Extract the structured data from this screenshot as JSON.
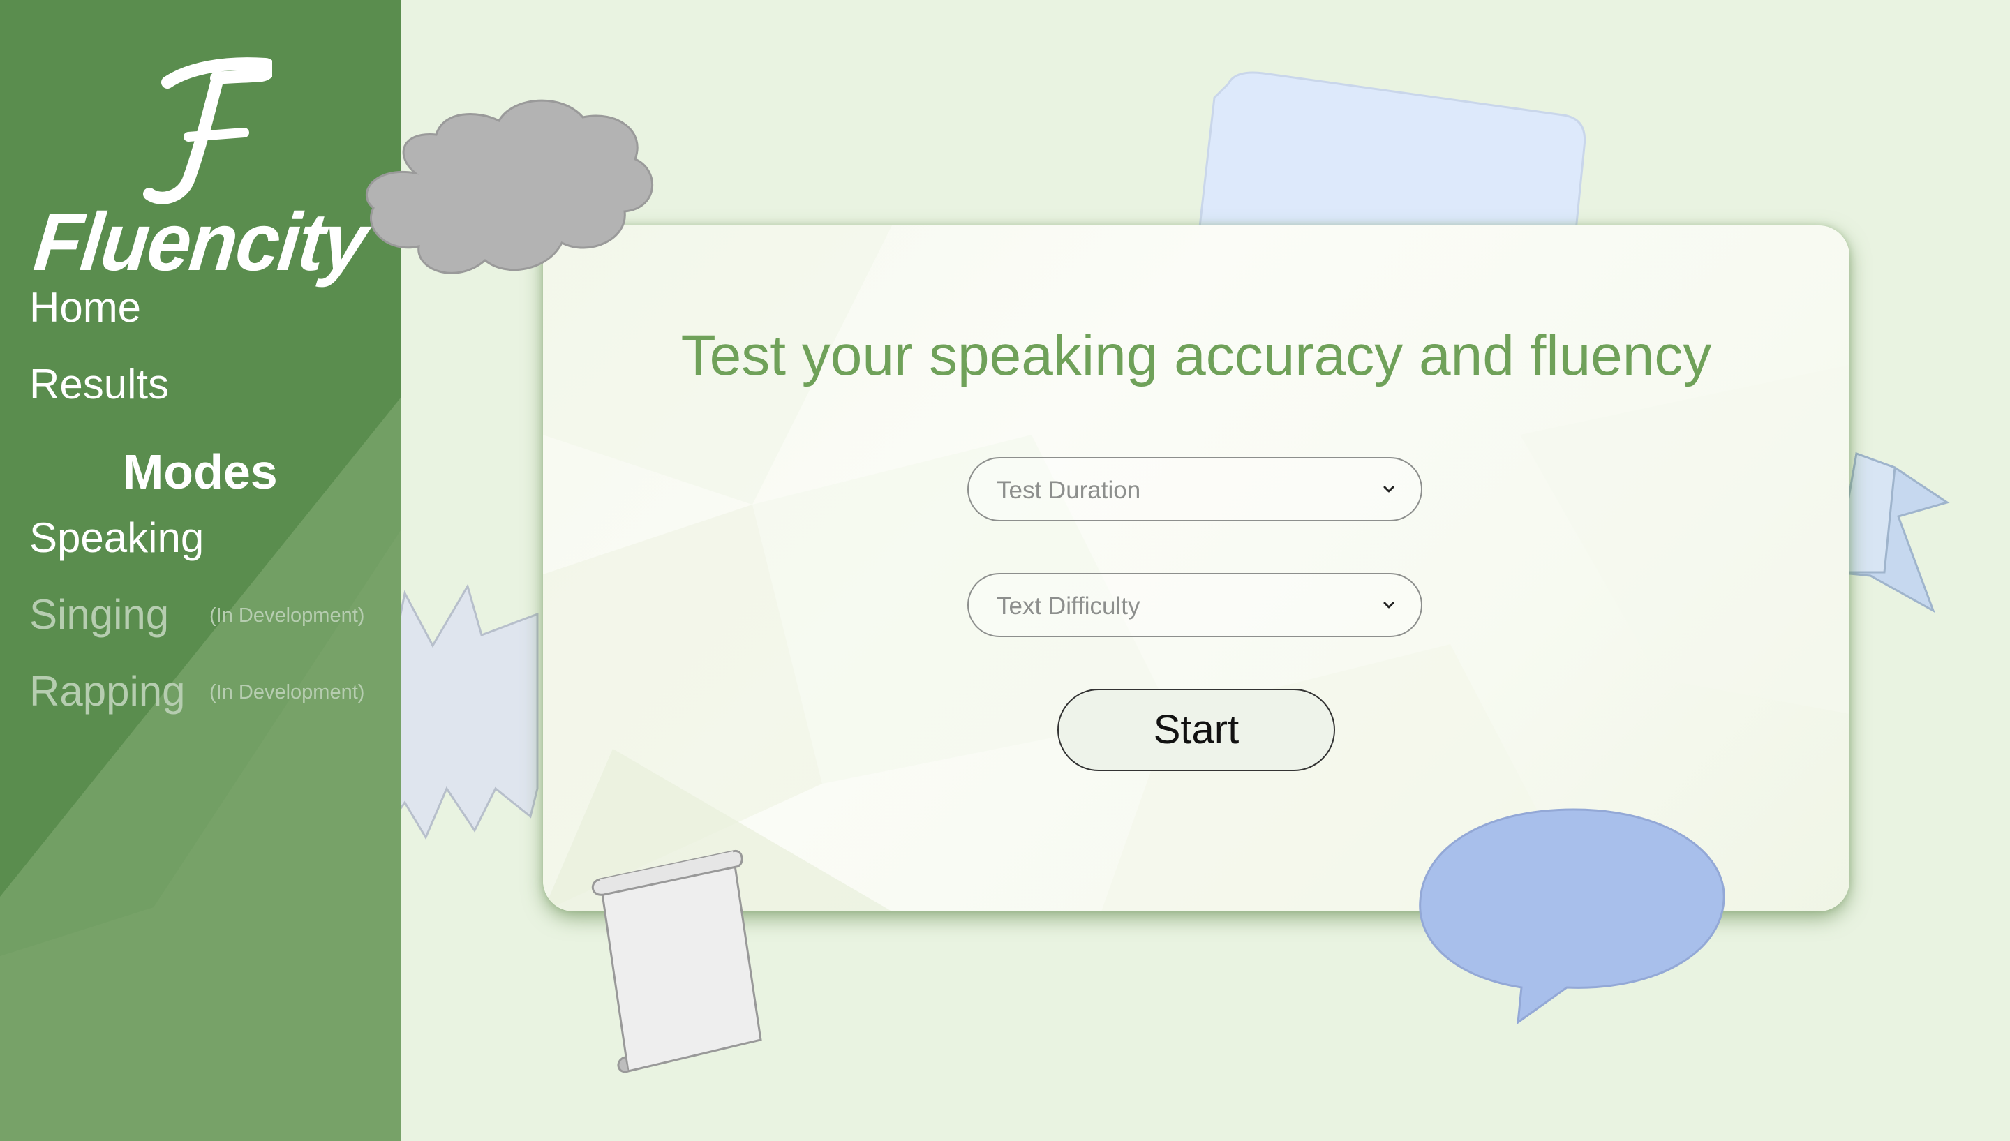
{
  "brand": {
    "logo_letter": "F",
    "name": "Fluencity"
  },
  "sidebar": {
    "nav": [
      {
        "label": "Home"
      },
      {
        "label": "Results"
      }
    ],
    "modes_heading": "Modes",
    "modes": [
      {
        "label": "Speaking",
        "note": ""
      },
      {
        "label": "Singing",
        "note": "(In Development)"
      },
      {
        "label": "Rapping",
        "note": "(In Development)"
      }
    ]
  },
  "main": {
    "title": "Test your speaking accuracy and fluency",
    "duration_select": {
      "placeholder": "Test Duration"
    },
    "difficulty_select": {
      "placeholder": "Text Difficulty"
    },
    "start_label": "Start"
  },
  "icons": {
    "select_arrow": "chevron-down-icon"
  },
  "colors": {
    "sidebar_green": "#5a8d4e",
    "sidebar_light_green": "#7ba56c",
    "background": "#e9f3e1",
    "title_green": "#6fa159",
    "cloud_gray": "#b3b3b3",
    "speech_bubble_blue": "#a8bfeb",
    "burst_blue_gray": "#dfe5ee",
    "card_blue": "#dde9fb"
  }
}
